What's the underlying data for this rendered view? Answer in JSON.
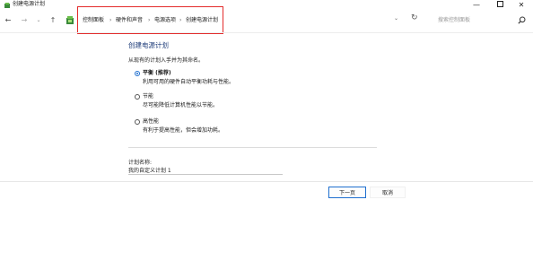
{
  "window": {
    "title": "创建电源计划",
    "minimize": "—",
    "close": "✕"
  },
  "address_bar": {
    "breadcrumb": [
      "控制面板",
      "硬件和声音",
      "电源选项",
      "创建电源计划"
    ],
    "separator": "›",
    "search_placeholder": "搜索控制面板"
  },
  "main": {
    "title": "创建电源计划",
    "intro": "从现有的计划入手并为其命名。",
    "options": [
      {
        "label": "平衡 (推荐)",
        "description": "利用可用的硬件自动平衡功耗与性能。",
        "selected": true
      },
      {
        "label": "节能",
        "description": "尽可能降低计算机性能以节能。",
        "selected": false
      },
      {
        "label": "高性能",
        "description": "有利于提高性能，但会增加功耗。",
        "selected": false
      }
    ],
    "plan_name_label": "计划名称:",
    "plan_name_value": "我的自定义计划 1"
  },
  "buttons": {
    "next": "下一页",
    "cancel": "取消"
  },
  "colors": {
    "highlight": "#e32b2b",
    "title": "#1f3d7a",
    "accent": "#1f6fcf"
  }
}
